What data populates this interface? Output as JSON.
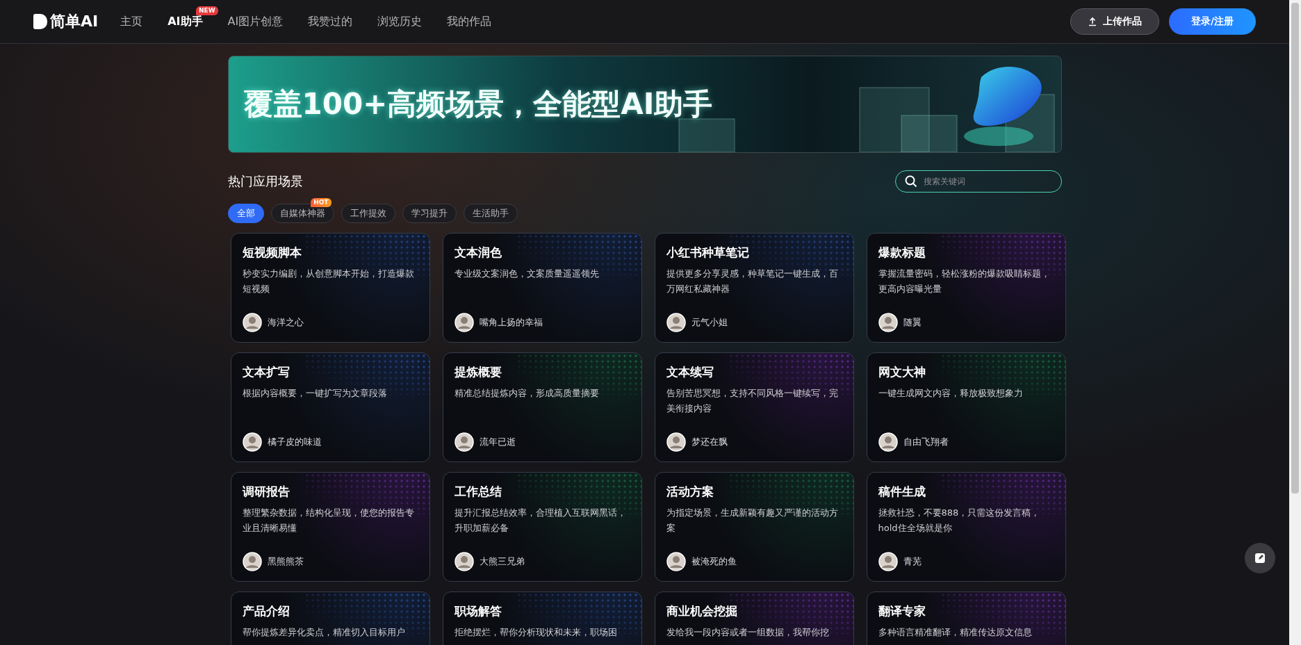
{
  "header": {
    "logo": "简单AI",
    "nav": [
      {
        "label": "主页",
        "selected": false
      },
      {
        "label": "AI助手",
        "selected": true,
        "badge": "NEW"
      },
      {
        "label": "AI图片创意",
        "selected": false
      },
      {
        "label": "我赞过的",
        "selected": false
      },
      {
        "label": "浏览历史",
        "selected": false
      },
      {
        "label": "我的作品",
        "selected": false
      }
    ],
    "upload_button": "上传作品",
    "login_button": "登录/注册"
  },
  "banner": {
    "headline": "覆盖100+高频场景，全能型AI助手"
  },
  "section": {
    "title": "热门应用场景",
    "search": {
      "placeholder": "搜索关键词"
    },
    "filters": [
      {
        "label": "全部",
        "selected": true
      },
      {
        "label": "自媒体神器",
        "selected": false,
        "badge": "HOT"
      },
      {
        "label": "工作提效",
        "selected": false
      },
      {
        "label": "学习提升",
        "selected": false
      },
      {
        "label": "生活助手",
        "selected": false
      }
    ]
  },
  "cards": [
    {
      "title": "短视频脚本",
      "description": "秒变实力编剧，从创意脚本开始，打造爆款短视频",
      "author": "海洋之心",
      "kind": "blue"
    },
    {
      "title": "文本润色",
      "description": "专业级文案润色，文案质量遥遥领先",
      "author": "嘴角上扬的幸福",
      "kind": "blue"
    },
    {
      "title": "小红书种草笔记",
      "description": "提供更多分享灵感，种草笔记一键生成，百万网红私藏神器",
      "author": "元气小姐",
      "kind": "blue"
    },
    {
      "title": "爆款标题",
      "description": "掌握流量密码，轻松涨粉的爆款吸睛标题，更高内容曝光量",
      "author": "随翼",
      "kind": "purple"
    },
    {
      "title": "文本扩写",
      "description": "根据内容概要，一键扩写为文章段落",
      "author": "橘子皮的味道",
      "kind": "blue"
    },
    {
      "title": "提炼概要",
      "description": "精准总结提炼内容，形成高质量摘要",
      "author": "流年已逝",
      "kind": "green"
    },
    {
      "title": "文本续写",
      "description": "告别苦思冥想，支持不同风格一键续写，完美衔接内容",
      "author": "梦还在飘",
      "kind": "purple"
    },
    {
      "title": "网文大神",
      "description": "一键生成网文内容，释放极致想象力",
      "author": "自由飞翔者",
      "kind": "green"
    },
    {
      "title": "调研报告",
      "description": "整理繁杂数据，结构化呈现，使您的报告专业且清晰易懂",
      "author": "黑熊熊茶",
      "kind": "purple"
    },
    {
      "title": "工作总结",
      "description": "提升汇报总结效率，合理植入互联网黑话，升职加薪必备",
      "author": "大熊三兄弟",
      "kind": "green"
    },
    {
      "title": "活动方案",
      "description": "为指定场景，生成新颖有趣又严谨的活动方案",
      "author": "被淹死的鱼",
      "kind": "green"
    },
    {
      "title": "稿件生成",
      "description": "拯救社恐，不要888，只需这份发言稿，hold住全场就是你",
      "author": "青芜",
      "kind": "purple"
    },
    {
      "title": "产品介绍",
      "description": "帮你提炼差异化卖点，精准切入目标用户",
      "kind": "blue"
    },
    {
      "title": "职场解答",
      "description": "拒绝摆烂，帮你分析现状和未来，职场困",
      "kind": "blue"
    },
    {
      "title": "商业机会挖掘",
      "description": "发给我一段内容或者一组数据，我帮你挖",
      "kind": "purple"
    },
    {
      "title": "翻译专家",
      "description": "多种语言精准翻译，精准传达原文信息",
      "kind": "purple"
    }
  ]
}
